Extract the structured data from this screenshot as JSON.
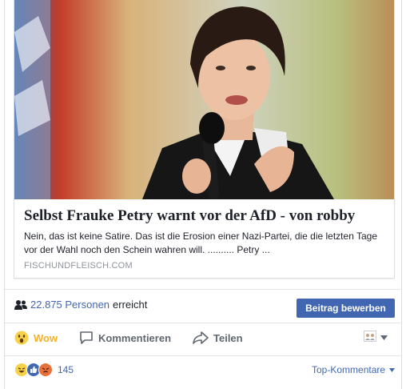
{
  "link_preview": {
    "title": "Selbst Frauke Petry warnt vor der AfD - von robby",
    "description": "Nein, das ist keine Satire. Das ist die Erosion einer Nazi-Partei, die die letzten Tage vor der Wahl noch den Schein wahren will. .......... Petry ...",
    "domain": "FISCHUNDFLEISCH.COM",
    "image_alt": "photo of a woman speaking into a microphone"
  },
  "reach": {
    "count": "22.875 Personen",
    "label": "erreicht",
    "icon": "people-icon"
  },
  "boost_button": "Beitrag bewerben",
  "actions": {
    "wow": "Wow",
    "comment": "Kommentieren",
    "share": "Teilen"
  },
  "viewer_icon": "page-avatar-icon",
  "reactions": {
    "count": "145",
    "icons": [
      "haha",
      "like",
      "angry"
    ]
  },
  "sort_label": "Top-Kommentare",
  "colors": {
    "facebook_blue": "#4267b2",
    "wow_yellow": "#f7b125",
    "text_gray": "#606770"
  }
}
